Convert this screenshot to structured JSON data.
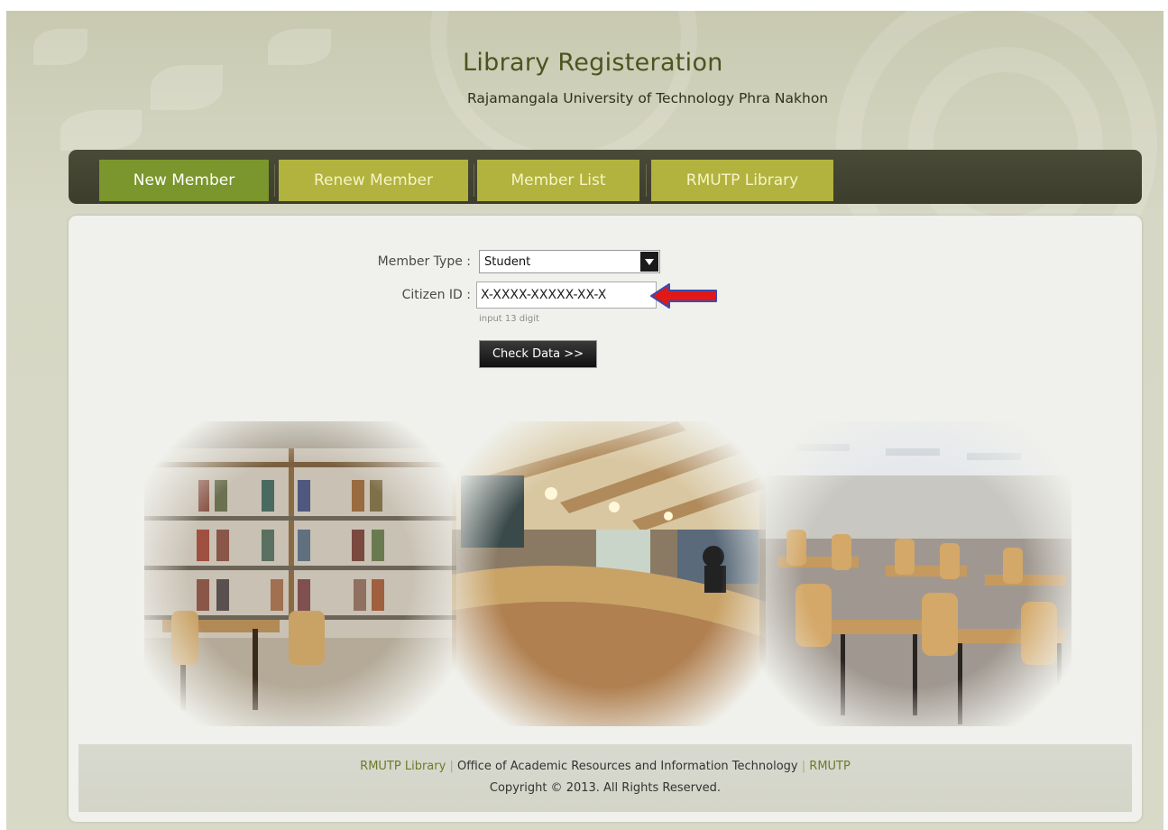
{
  "header": {
    "title": "Library Registeration",
    "subtitle": "Rajamangala University of Technology Phra Nakhon"
  },
  "nav": {
    "tabs": [
      {
        "label": "New Member",
        "active": true
      },
      {
        "label": "Renew Member",
        "active": false
      },
      {
        "label": "Member List",
        "active": false
      },
      {
        "label": "RMUTP Library",
        "active": false
      }
    ]
  },
  "form": {
    "member_type_label": "Member Type :",
    "member_type_value": "Student",
    "citizen_id_label": "Citizen ID :",
    "citizen_id_value": "X-XXXX-XXXXX-XX-X",
    "citizen_id_hint": "input 13 digit",
    "check_button": "Check Data >>"
  },
  "footer": {
    "link1": "RMUTP Library",
    "separator": "|",
    "office": "Office of Academic Resources and Information Technology",
    "link2": "RMUTP",
    "copyright": "Copyright © 2013. All Rights Reserved."
  },
  "colors": {
    "active_tab": "#7a962c",
    "inactive_tab": "#b1b33e",
    "navbar": "#3d3d2d",
    "title": "#4c5420",
    "annotation_arrow": "#e01818"
  },
  "icons": {
    "dropdown": "chevron-down-icon",
    "annotation": "red-arrow-icon"
  }
}
